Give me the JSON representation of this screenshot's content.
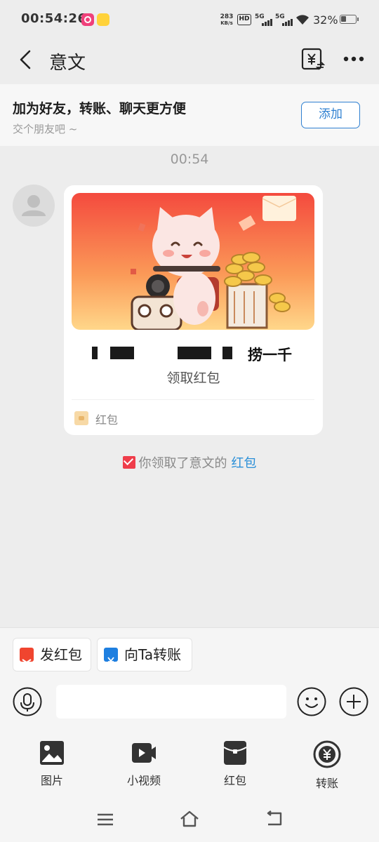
{
  "status_bar": {
    "time": "00:54:26",
    "speed_value": "283",
    "speed_unit": "KB/s",
    "hd": "HD",
    "signal1": "5G",
    "signal2": "5G",
    "battery": "32%"
  },
  "header": {
    "title": "意文"
  },
  "banner": {
    "title": "加为好友，转账、聊天更方便",
    "subtitle": "交个朋友吧 ~",
    "add_label": "添加"
  },
  "chat": {
    "timestamp": "00:54",
    "red_packet": {
      "message_visible": "捞一千",
      "action": "领取红包",
      "footer_label": "红包"
    },
    "notice": {
      "text": "你领取了意文的",
      "link": "红包"
    }
  },
  "quick_actions": {
    "send_red_packet": "发红包",
    "transfer_to": "向Ta转账"
  },
  "input": {
    "placeholder": ""
  },
  "tools": [
    {
      "label": "图片",
      "icon": "image-icon"
    },
    {
      "label": "小视频",
      "icon": "video-icon"
    },
    {
      "label": "红包",
      "icon": "red-packet-icon"
    },
    {
      "label": "转账",
      "icon": "transfer-icon"
    }
  ],
  "colors": {
    "accent": "#2f80d1",
    "red_packet": "#ef3d4a",
    "link": "#2a8fd8",
    "background": "#ededed"
  }
}
